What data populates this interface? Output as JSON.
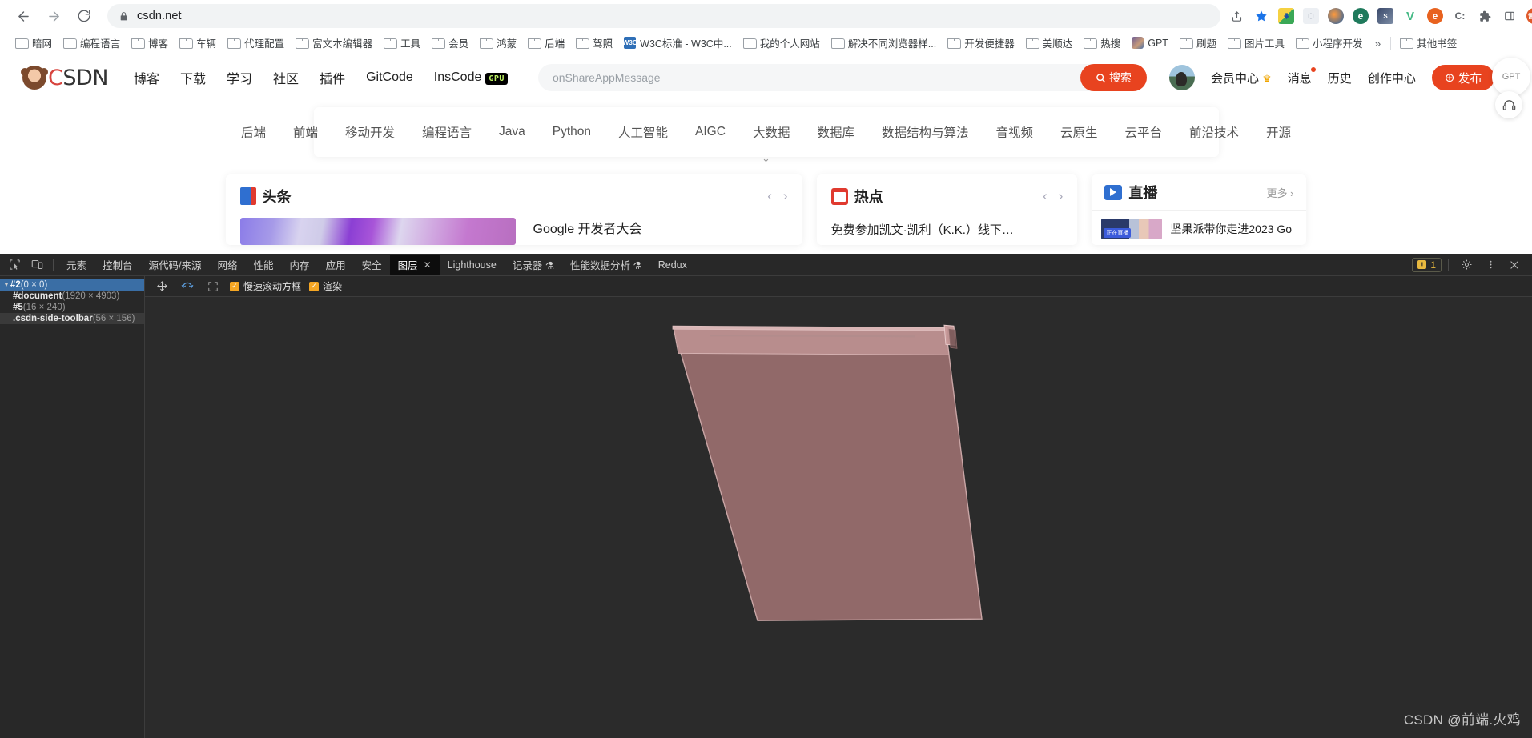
{
  "browser": {
    "url": "csdn.net",
    "nav": {
      "back": "back-arrow",
      "forward": "forward-arrow",
      "reload": "reload"
    },
    "toolbar_icons": [
      "share-icon",
      "bookmark-star-icon",
      "download-ext-icon",
      "grid-ext-icon",
      "fire-ext-icon",
      "e-ext-icon",
      "s-ext-icon",
      "v-ext-icon",
      "e2-ext-icon",
      "c-ext-icon",
      "puzzle-icon",
      "sidepanel-icon",
      "profile-avatar",
      "chrome-menu-icon"
    ]
  },
  "bookmarks": {
    "items": [
      {
        "label": "暗网",
        "type": "folder"
      },
      {
        "label": "编程语言",
        "type": "folder"
      },
      {
        "label": "博客",
        "type": "folder"
      },
      {
        "label": "车辆",
        "type": "folder"
      },
      {
        "label": "代理配置",
        "type": "folder"
      },
      {
        "label": "富文本编辑器",
        "type": "folder"
      },
      {
        "label": "工具",
        "type": "folder"
      },
      {
        "label": "会员",
        "type": "folder"
      },
      {
        "label": "鸿蒙",
        "type": "folder"
      },
      {
        "label": "后端",
        "type": "folder"
      },
      {
        "label": "驾照",
        "type": "folder"
      },
      {
        "label": "W3C标准 - W3C中...",
        "type": "w3c"
      },
      {
        "label": "我的个人网站",
        "type": "folder"
      },
      {
        "label": "解决不同浏览器样...",
        "type": "folder"
      },
      {
        "label": "开发便捷器",
        "type": "folder"
      },
      {
        "label": "美顺达",
        "type": "folder"
      },
      {
        "label": "热搜",
        "type": "folder"
      },
      {
        "label": "GPT",
        "type": "gpt"
      },
      {
        "label": "刷题",
        "type": "folder"
      },
      {
        "label": "图片工具",
        "type": "folder"
      },
      {
        "label": "小程序开发",
        "type": "folder"
      }
    ],
    "overflow": "»",
    "other": "其他书签"
  },
  "csdn": {
    "logo": {
      "c": "C",
      "s": "S",
      "d": "D",
      "n": "N"
    },
    "nav": [
      "博客",
      "下载",
      "学习",
      "社区",
      "插件",
      "GitCode",
      "InsCode"
    ],
    "gpu_badge": "GPU",
    "search": {
      "value": "onShareAppMessage",
      "placeholder": "搜索",
      "button": "搜索"
    },
    "header_right": [
      "会员中心",
      "消息",
      "历史",
      "创作中心"
    ],
    "publish_button": "发布",
    "side_buttons": {
      "top": "GPT",
      "bottom": "headset-icon"
    },
    "categories": [
      "后端",
      "前端",
      "移动开发",
      "编程语言",
      "Java",
      "Python",
      "人工智能",
      "AIGC",
      "大数据",
      "数据库",
      "数据结构与算法",
      "音视频",
      "云原生",
      "云平台",
      "前沿技术",
      "开源"
    ],
    "cards": {
      "headline": {
        "title": "头条",
        "item": "Google 开发者大会"
      },
      "hot": {
        "title": "热点",
        "item": "免费参加凯文·凯利（K.K.）线下…"
      },
      "live": {
        "title": "直播",
        "more": "更多",
        "badge": "正在直播",
        "item": "坚果派带你走进2023 Go"
      }
    }
  },
  "devtools": {
    "tabs": [
      {
        "label": "元素",
        "active": false,
        "close": false
      },
      {
        "label": "控制台",
        "active": false,
        "close": false
      },
      {
        "label": "源代码/来源",
        "active": false,
        "close": false
      },
      {
        "label": "网络",
        "active": false,
        "close": false
      },
      {
        "label": "性能",
        "active": false,
        "close": false
      },
      {
        "label": "内存",
        "active": false,
        "close": false
      },
      {
        "label": "应用",
        "active": false,
        "close": false
      },
      {
        "label": "安全",
        "active": false,
        "close": false
      },
      {
        "label": "图层",
        "active": true,
        "close": true
      },
      {
        "label": "Lighthouse",
        "active": false,
        "close": false
      },
      {
        "label": "记录器 ⚗",
        "active": false,
        "close": false
      },
      {
        "label": "性能数据分析 ⚗",
        "active": false,
        "close": false
      },
      {
        "label": "Redux",
        "active": false,
        "close": false
      }
    ],
    "warnings_count": "1",
    "left_icons": [
      "inspect-icon",
      "device-toolbar-icon"
    ],
    "right_icons": [
      "settings-gear-icon",
      "more-vertical-icon",
      "close-icon"
    ],
    "layers_tree": [
      {
        "name": "#2",
        "dim": "(0 × 0)",
        "indent": 0,
        "expander": "▼",
        "selected": true,
        "hover": false
      },
      {
        "name": "#document",
        "dim": "(1920 × 4903)",
        "indent": 1,
        "expander": "",
        "selected": false,
        "hover": false
      },
      {
        "name": "#5",
        "dim": "(16 × 240)",
        "indent": 1,
        "expander": "",
        "selected": false,
        "hover": false
      },
      {
        "name": ".csdn-side-toolbar",
        "dim": "(56 × 156)",
        "indent": 1,
        "expander": "",
        "selected": false,
        "hover": true
      }
    ],
    "viewer_toolbar": {
      "pan_icon": "pan-move-icon",
      "rotate_icon": "rotate-icon",
      "reset_icon": "reset-zoom-icon",
      "slow_scroll_label": "慢速滚动方框",
      "slow_scroll_checked": true,
      "paint_label": "渲染",
      "paint_checked": true
    },
    "layer_color": "#a07a7a",
    "background": "#2b2b2b"
  },
  "watermark": "CSDN @前端.火鸡"
}
